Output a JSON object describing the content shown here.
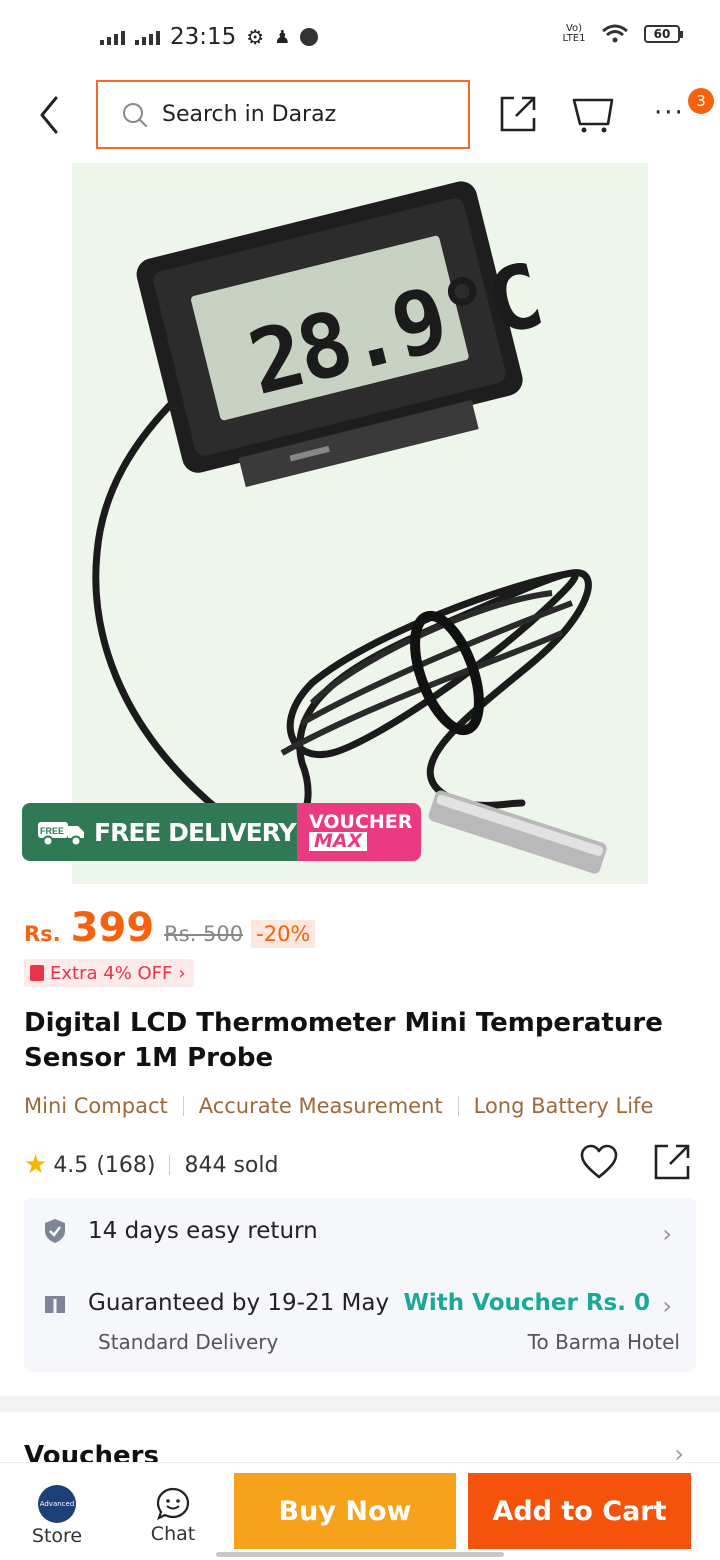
{
  "status_bar": {
    "time": "23:15",
    "battery": "60",
    "network": "Vo) LTE1"
  },
  "header": {
    "search_placeholder": "Search in Daraz",
    "cart_badge": "3"
  },
  "promo": {
    "free_tag": "FREE",
    "free_delivery": "FREE DELIVERY",
    "voucher": "VOUCHER",
    "max": "MAX"
  },
  "product_image": {
    "display_reading": "28.9°C"
  },
  "price": {
    "currency": "Rs.",
    "amount": "399",
    "original": "Rs. 500",
    "discount": "-20%"
  },
  "extra_offer": "Extra 4% OFF",
  "title": "Digital LCD Thermometer Mini Temperature Sensor 1M Probe",
  "tags": [
    "Mini Compact",
    "Accurate Measurement",
    "Long Battery Life"
  ],
  "rating": {
    "value": "4.5",
    "count": "(168)",
    "sold": "844 sold"
  },
  "service": {
    "return": "14 days easy return",
    "guarantee": "Guaranteed by 19-21 May",
    "voucher": "With Voucher Rs. 0",
    "delivery_type": "Standard Delivery",
    "destination": "To Barma Hotel"
  },
  "vouchers_heading": "Vouchers",
  "bottom": {
    "store_label": "Store",
    "store_logo_text": "Advanced",
    "chat_label": "Chat",
    "buy_now": "Buy Now",
    "add_to_cart": "Add to Cart"
  },
  "colors": {
    "accent": "#f5620f",
    "buy_now": "#f7a21b",
    "add_to_cart": "#f5520b",
    "teal": "#1aa89a",
    "free_delivery": "#2f7a55",
    "voucher_max": "#ec3a80"
  }
}
